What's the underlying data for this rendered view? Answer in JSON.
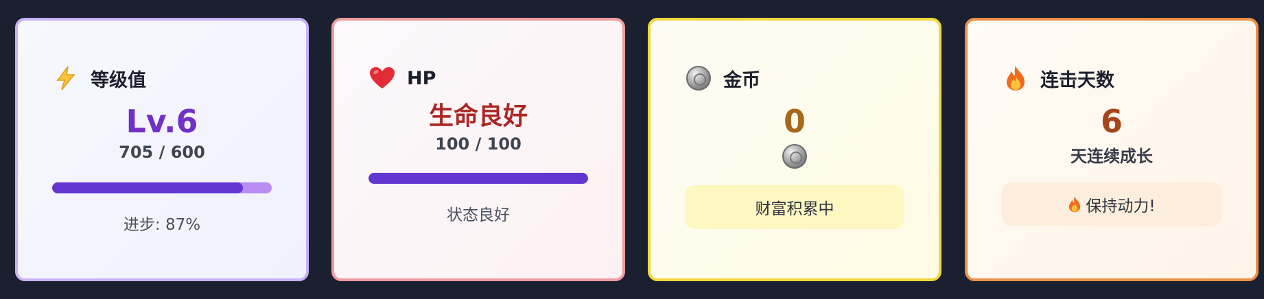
{
  "level_card": {
    "icon": "lightning-icon",
    "title": "等级值",
    "level": "Lv.6",
    "xp": "705 / 600",
    "progress_fraction": 0.87,
    "progress_label": "进步: 87%",
    "color_border": "#c8b1f6",
    "color_value": "#7131c6",
    "color_fill": "#6336d1",
    "color_track": "#b88cf0"
  },
  "hp_card": {
    "icon": "heart-icon",
    "title": "HP",
    "status_title": "生命良好",
    "hp": "100 / 100",
    "progress_fraction": 1.0,
    "status_note": "状态良好",
    "color_border": "#ee9ba0",
    "color_value": "#ab2623",
    "color_fill": "#6336d1"
  },
  "gold_card": {
    "icon": "coin-icon",
    "title": "金币",
    "amount": "0",
    "coin_icon": "coin-icon",
    "pill_text": "财富积累中",
    "color_border": "#f1d63e",
    "color_value": "#a8681c",
    "color_pill": "#fff7c2"
  },
  "streak_card": {
    "icon": "fire-icon",
    "title": "连击天数",
    "days": "6",
    "days_label": "天连续成长",
    "pill_icon": "fire-icon",
    "pill_text": "保持动力!",
    "color_border": "#ec8e46",
    "color_value": "#a6461b",
    "color_pill": "#fdeddc"
  }
}
